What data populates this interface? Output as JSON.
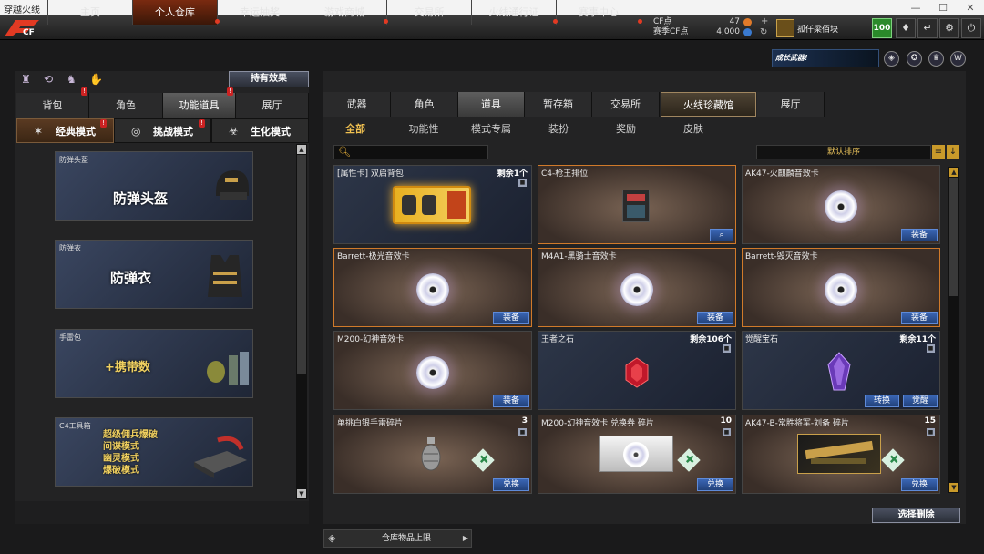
{
  "window": {
    "title": "穿越火线",
    "min": "—",
    "max": "☐",
    "close": "✕"
  },
  "logo": {
    "text": "CF"
  },
  "nav": {
    "tabs": [
      {
        "label": "主页"
      },
      {
        "label": "个人仓库"
      },
      {
        "label": "幸运抽奖"
      },
      {
        "label": "游戏商城"
      },
      {
        "label": "交易所"
      },
      {
        "label": "火线通行证"
      },
      {
        "label": "赛事中心"
      }
    ]
  },
  "currency": {
    "cf_label": "CF点",
    "cf_value": "47",
    "event_label": "赛季CF点",
    "event_value": "4,000"
  },
  "user": {
    "name": "孤仟梁佰块",
    "level": "100"
  },
  "left": {
    "hold_effect": "持有效果",
    "tabs": [
      {
        "label": "背包"
      },
      {
        "label": "角色"
      },
      {
        "label": "功能道具"
      },
      {
        "label": "展厅"
      }
    ],
    "modes": [
      {
        "label": "经典模式"
      },
      {
        "label": "挑战模式"
      },
      {
        "label": "生化模式"
      }
    ],
    "cards": [
      {
        "caption": "防弹头盔",
        "title": "防弹头盔"
      },
      {
        "caption": "防弹衣",
        "title": "防弹衣"
      },
      {
        "caption": "手雷包",
        "title": "+携带数"
      },
      {
        "caption": "C4工具箱",
        "lines": [
          "超级佣兵爆破",
          "间谍模式",
          "幽灵模式",
          "爆破模式"
        ]
      }
    ]
  },
  "promo": {
    "text": "成长武器!"
  },
  "right": {
    "tabs": [
      {
        "label": "武器"
      },
      {
        "label": "角色"
      },
      {
        "label": "道具"
      },
      {
        "label": "暂存箱"
      },
      {
        "label": "交易所"
      },
      {
        "label": "火线珍藏馆"
      },
      {
        "label": "展厅"
      }
    ],
    "subtabs": [
      {
        "label": "全部"
      },
      {
        "label": "功能性"
      },
      {
        "label": "模式专属"
      },
      {
        "label": "装扮"
      },
      {
        "label": "奖励"
      },
      {
        "label": "皮肤"
      }
    ],
    "sort_label": "默认排序",
    "items": [
      {
        "name": "[属性卡] 双启背包",
        "qty": "剩余1个"
      },
      {
        "name": "C4-枪王排位",
        "qty": ""
      },
      {
        "name": "AK47-火麒麟音效卡",
        "qty": "",
        "btn": "装备"
      },
      {
        "name": "Barrett-极光音效卡",
        "qty": "",
        "btn": "装备"
      },
      {
        "name": "M4A1-黑骑士音效卡",
        "qty": "",
        "btn": "装备"
      },
      {
        "name": "Barrett-毁灭音效卡",
        "qty": "",
        "btn": "装备"
      },
      {
        "name": "M200-幻神音效卡",
        "qty": "",
        "btn": "装备"
      },
      {
        "name": "王者之石",
        "qty": "剩余106个"
      },
      {
        "name": "觉醒宝石",
        "qty": "剩余11个",
        "btn": "转换",
        "btn2": "觉醒"
      },
      {
        "name": "单挑白银手雷碎片",
        "qty": "3",
        "btn": "兑换"
      },
      {
        "name": "M200-幻神音效卡 兑换券 碎片",
        "qty": "10",
        "btn": "兑换"
      },
      {
        "name": "AK47-B-常胜将军-刘备 碎片",
        "qty": "15",
        "btn": "兑换"
      }
    ],
    "delete_selected": "选择删除",
    "storage_limit": "仓库物品上限"
  }
}
